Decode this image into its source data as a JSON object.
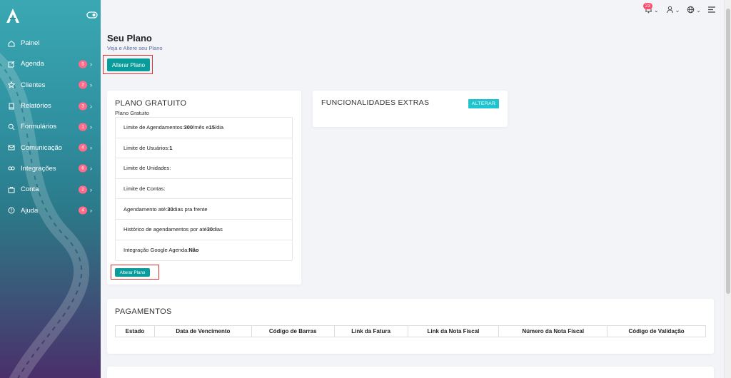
{
  "sidebar": {
    "items": [
      {
        "label": "Painel",
        "icon": "home-icon",
        "badge": ""
      },
      {
        "label": "Agenda",
        "icon": "edit-icon",
        "badge": "5"
      },
      {
        "label": "Clientes",
        "icon": "star-icon",
        "badge": "2"
      },
      {
        "label": "Relatórios",
        "icon": "book-icon",
        "badge": "3"
      },
      {
        "label": "Formulários",
        "icon": "search-icon",
        "badge": "1"
      },
      {
        "label": "Comunicação",
        "icon": "mail-icon",
        "badge": "4"
      },
      {
        "label": "Integrações",
        "icon": "link-icon",
        "badge": "6"
      },
      {
        "label": "Conta",
        "icon": "briefcase-icon",
        "badge": "2"
      },
      {
        "label": "Ajuda",
        "icon": "help-icon",
        "badge": "4"
      }
    ]
  },
  "topbar": {
    "notifications_count": "23",
    "chevron": "⌄"
  },
  "page": {
    "title": "Seu Plano",
    "subtitle": "Veja e Altere seu Plano",
    "alterar_plano_label": "Alterar Plano"
  },
  "plan_card": {
    "title": "PLANO GRATUITO",
    "subtitle": "Plano Gratuito",
    "items": [
      {
        "pre": "Limite de Agendamentos: ",
        "b1": "300",
        "mid": "/mês e ",
        "b2": "15",
        "post": "/dia"
      },
      {
        "pre": "Limite de Usuários: ",
        "b1": "1",
        "mid": "",
        "b2": "",
        "post": ""
      },
      {
        "pre": "Limite de Unidades:",
        "b1": "",
        "mid": "",
        "b2": "",
        "post": ""
      },
      {
        "pre": "Limite de Contas:",
        "b1": "",
        "mid": "",
        "b2": "",
        "post": ""
      },
      {
        "pre": "Agendamento até: ",
        "b1": "30",
        "mid": " dias pra frente",
        "b2": "",
        "post": ""
      },
      {
        "pre": "Histórico de agendamentos por até ",
        "b1": "30",
        "mid": " dias",
        "b2": "",
        "post": ""
      },
      {
        "pre": "Integração Google Agenda: ",
        "b1": "Não",
        "mid": "",
        "b2": "",
        "post": ""
      }
    ],
    "button_label": "Alterar Plano"
  },
  "extras_card": {
    "title": "FUNCIONALIDADES EXTRAS",
    "button_label": "ALTERAR"
  },
  "payments": {
    "title": "PAGAMENTOS",
    "columns": [
      "Estado",
      "Data de Vencimento",
      "Código de Barras",
      "Link da Fatura",
      "Link da Nota Fiscal",
      "Número da Nota Fiscal",
      "Código de Validação"
    ]
  },
  "colors": {
    "accent": "#0a9b9b",
    "badge": "#ff6b8a",
    "highlight": "#e03131"
  }
}
